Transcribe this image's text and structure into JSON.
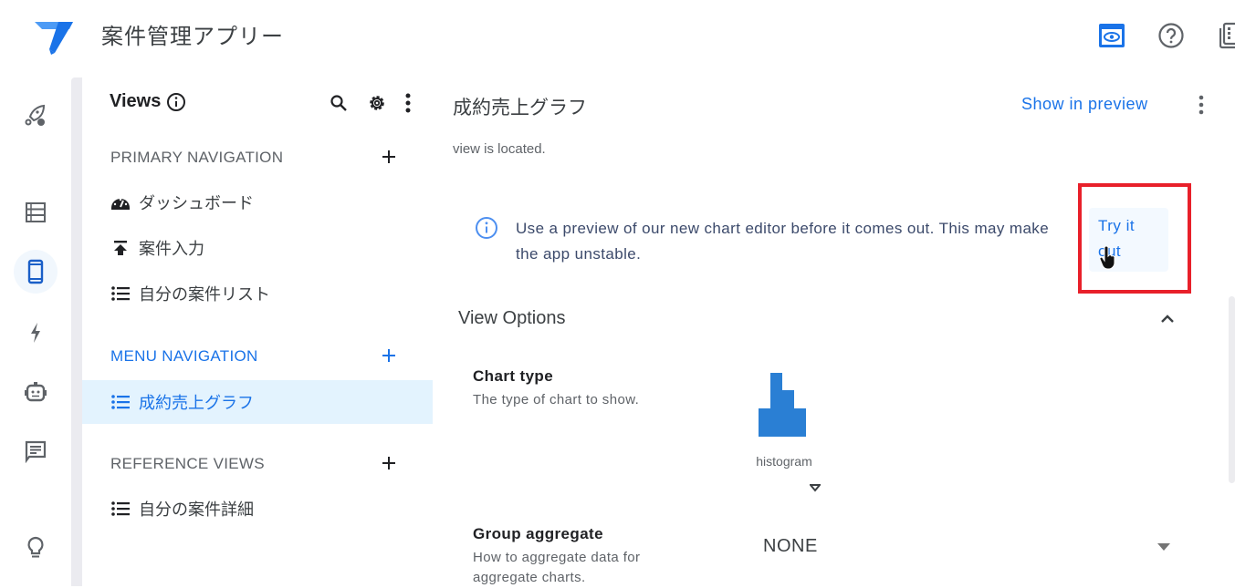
{
  "app": {
    "title": "案件管理アプリー",
    "top_icons": [
      "preview-eye-icon",
      "help-icon",
      "copy-app-icon"
    ]
  },
  "rail": {
    "items": [
      {
        "name": "deploy",
        "icon": "rocket-icon"
      },
      {
        "name": "data",
        "icon": "table-icon"
      },
      {
        "name": "app",
        "icon": "mobile-icon",
        "active": true
      },
      {
        "name": "automation",
        "icon": "bolt-icon"
      },
      {
        "name": "bots",
        "icon": "robot-icon"
      },
      {
        "name": "feedback",
        "icon": "chat-icon"
      },
      {
        "name": "ideas",
        "icon": "lightbulb-icon"
      }
    ]
  },
  "views_panel": {
    "title": "Views",
    "sections": [
      {
        "label": "PRIMARY NAVIGATION",
        "items": [
          {
            "label": "ダッシュボード",
            "icon": "dashboard-icon"
          },
          {
            "label": "案件入力",
            "icon": "upload-icon"
          },
          {
            "label": "自分の案件リスト",
            "icon": "list-icon"
          }
        ]
      },
      {
        "label": "MENU NAVIGATION",
        "items": [
          {
            "label": "成約売上グラフ",
            "icon": "list-icon",
            "selected": true
          }
        ]
      },
      {
        "label": "REFERENCE VIEWS",
        "items": [
          {
            "label": "自分の案件詳細",
            "icon": "list-icon"
          }
        ]
      }
    ]
  },
  "main": {
    "title": "成約売上グラフ",
    "show_in_preview": "Show in preview",
    "truncated_text": "view is located.",
    "banner": {
      "text": "Use a preview of our new chart editor before it comes out. This may make the app unstable.",
      "button": "Try it out"
    },
    "view_options": {
      "title": "View Options",
      "chart_type": {
        "label": "Chart type",
        "description": "The type of chart to show.",
        "value": "histogram"
      },
      "group_aggregate": {
        "label": "Group aggregate",
        "description": "How to aggregate data for aggregate charts.",
        "value": "NONE"
      }
    }
  },
  "colors": {
    "accent": "#1a73e8",
    "selected_bg": "#e3f3fe",
    "highlight": "#e8202a",
    "histogram": "#2a7fd4"
  }
}
